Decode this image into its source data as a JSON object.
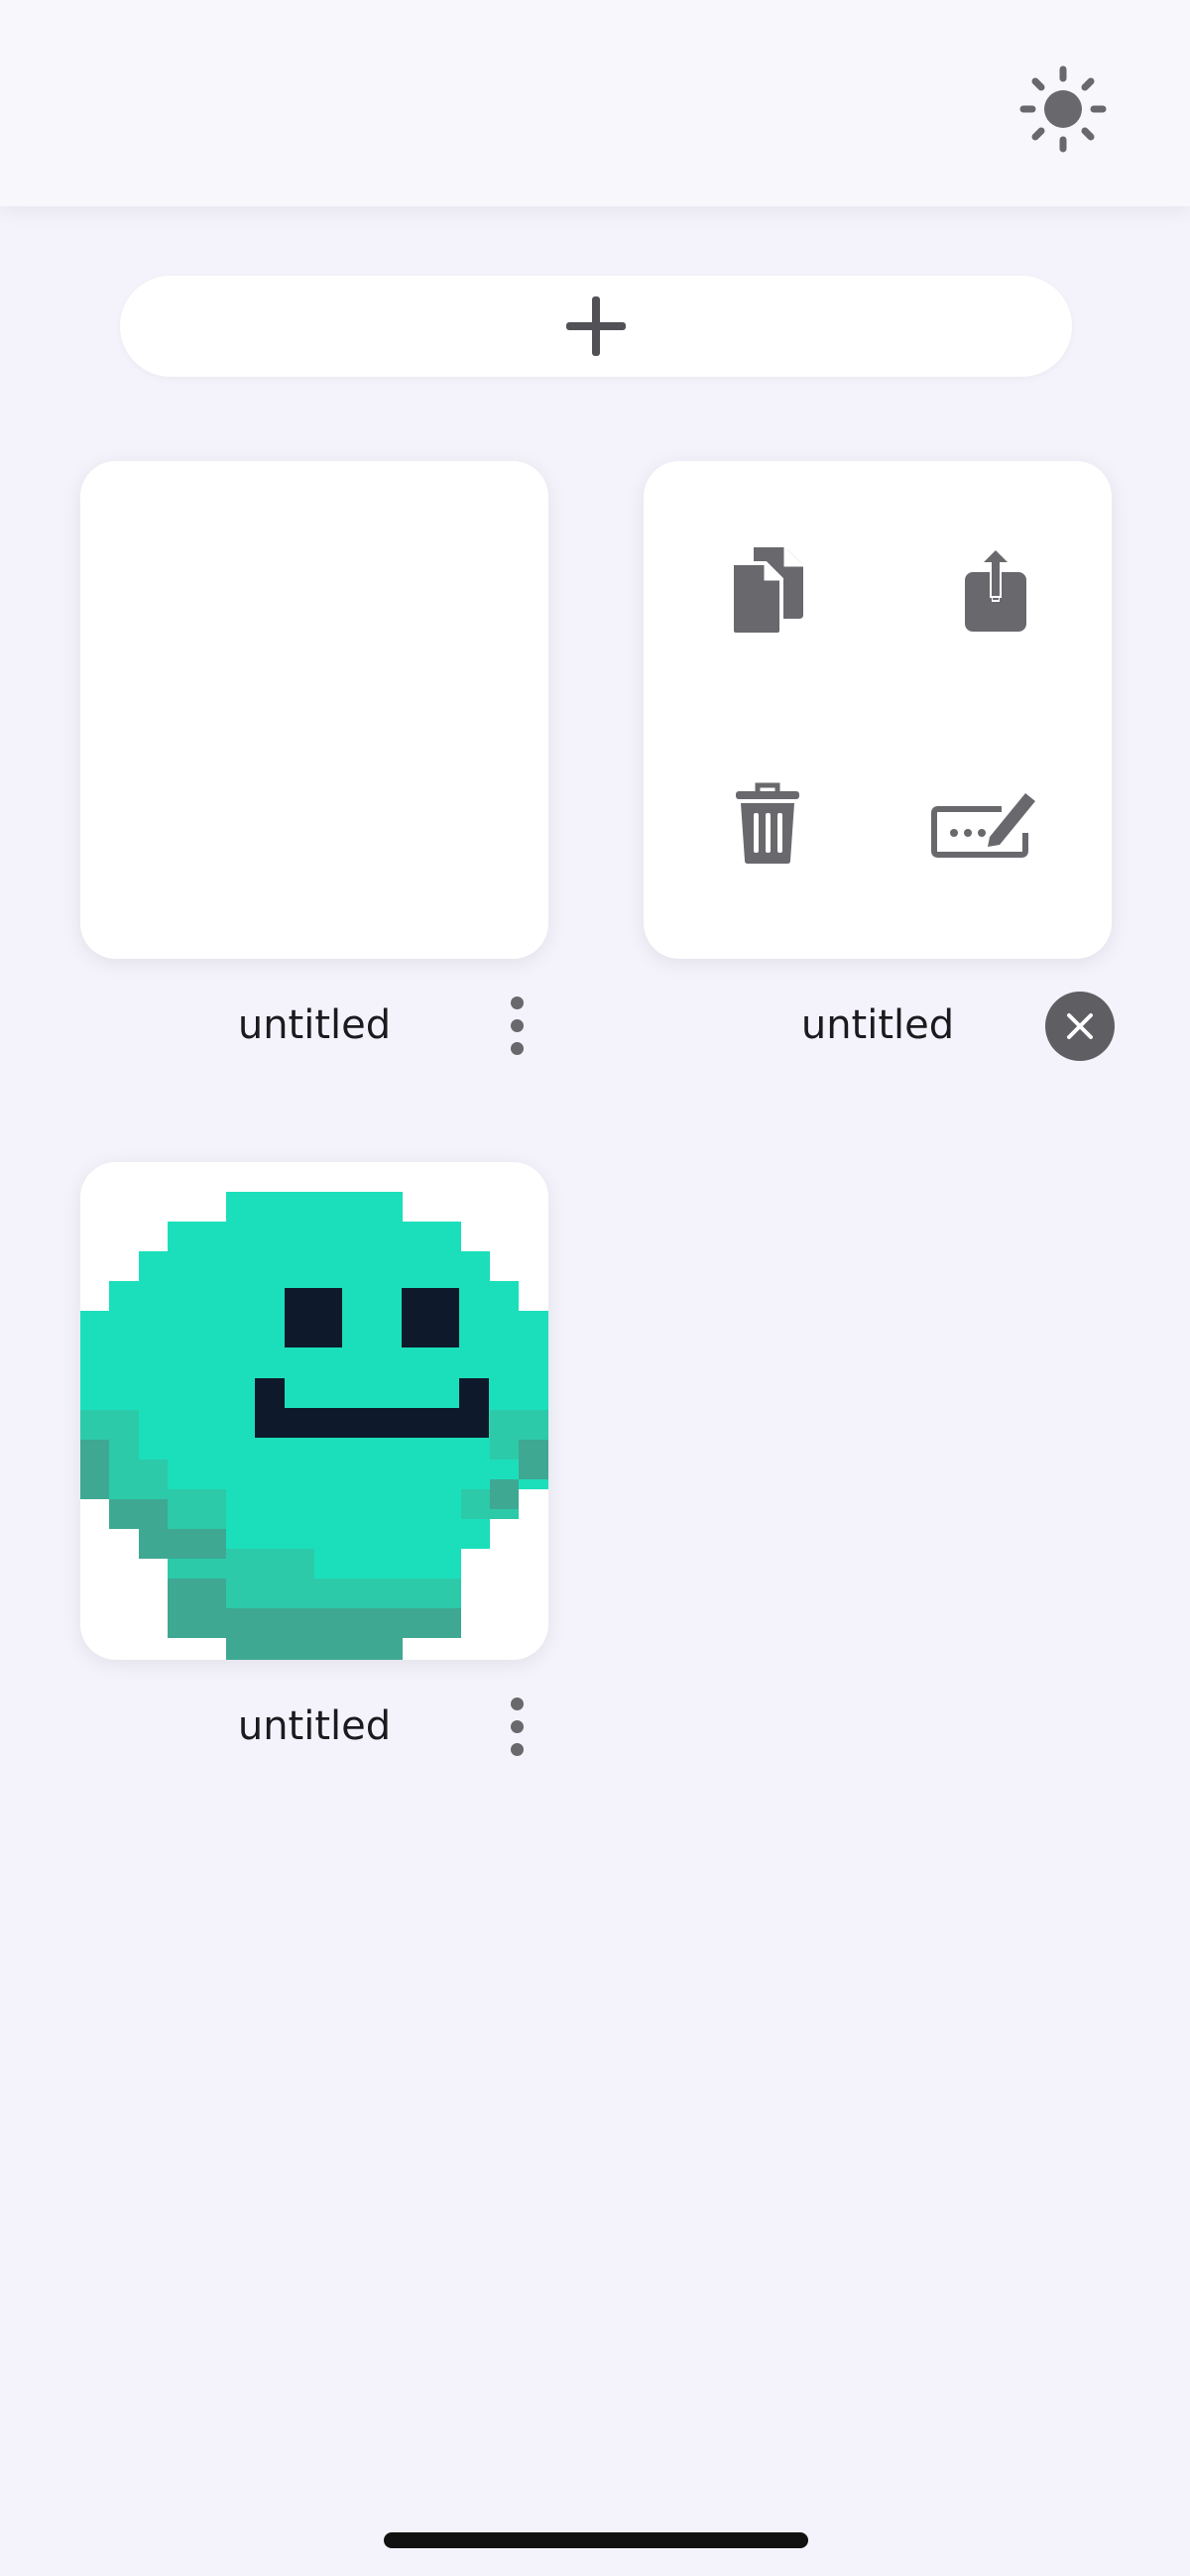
{
  "header": {
    "theme_icon": "sun-icon"
  },
  "toolbar": {
    "add_icon": "plus-icon"
  },
  "projects": [
    {
      "name": "untitled",
      "thumbnail": "blank",
      "state": "normal"
    },
    {
      "name": "untitled",
      "state": "actions-open",
      "actions": [
        {
          "icon": "duplicate-icon"
        },
        {
          "icon": "share-icon"
        },
        {
          "icon": "trash-icon"
        },
        {
          "icon": "rename-icon"
        }
      ]
    },
    {
      "name": "untitled",
      "thumbnail": "pixel-smiley",
      "state": "normal"
    }
  ],
  "colors": {
    "background": "#f4f3fb",
    "icon_gray": "#69686d",
    "smiley_teal": "#1bdfbb",
    "smiley_teal_mid": "#2ccaa9",
    "smiley_teal_dark": "#3ea893",
    "smiley_face": "#0e1a2b"
  }
}
